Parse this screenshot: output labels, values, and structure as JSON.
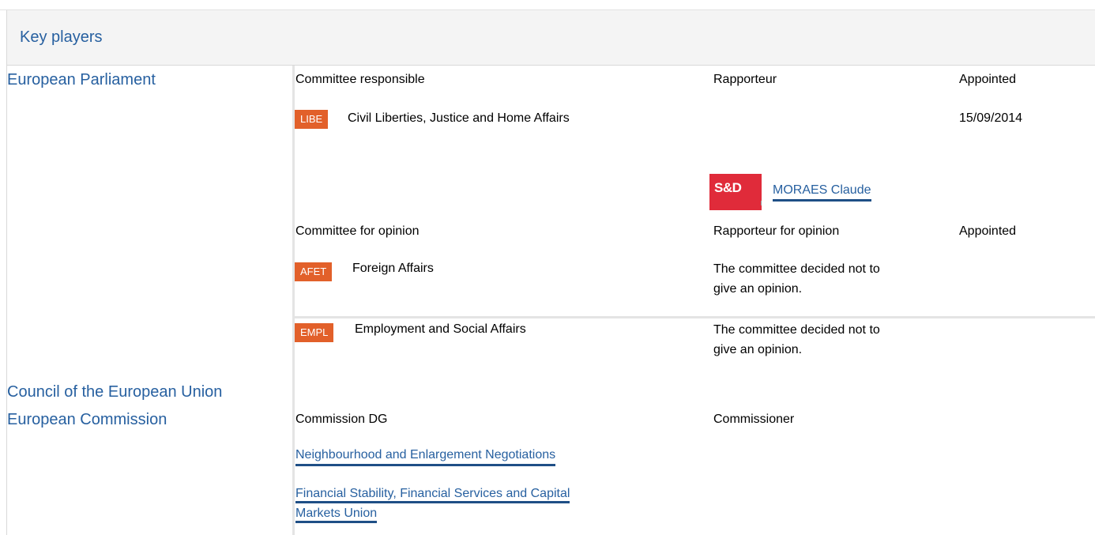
{
  "header": {
    "title": "Key players"
  },
  "bodies": {
    "ep": "European Parliament",
    "council": "Council of the European Union",
    "commission": "European Commission"
  },
  "responsible": {
    "heading": "Committee responsible",
    "rapporteur_heading": "Rapporteur",
    "appointed_heading": "Appointed",
    "committee": {
      "code": "LIBE",
      "name": "Civil Liberties, Justice and Home Affairs",
      "appointed": "15/09/2014"
    },
    "rapporteur": {
      "group_logo": "S&D",
      "name": "MORAES Claude"
    }
  },
  "opinion": {
    "heading": "Committee for opinion",
    "rapporteur_heading": "Rapporteur for opinion",
    "appointed_heading": "Appointed",
    "committees": [
      {
        "code": "AFET",
        "name": "Foreign Affairs",
        "note_line1": "The committee decided not to",
        "note_line2": "give an opinion."
      },
      {
        "code": "EMPL",
        "name": "Employment and Social Affairs",
        "note_line1": "The committee decided not to",
        "note_line2": "give an opinion."
      }
    ]
  },
  "commission": {
    "dg_heading": "Commission DG",
    "commissioner_heading": "Commissioner",
    "dgs": [
      {
        "line1": "Neighbourhood and Enlargement Negotiations"
      },
      {
        "line1": "Financial Stability, Financial Services and Capital",
        "line2": "Markets Union"
      }
    ]
  },
  "colors": {
    "link": "#2760a0",
    "badge": "#e2602a",
    "sd_logo": "#e02b3a"
  }
}
